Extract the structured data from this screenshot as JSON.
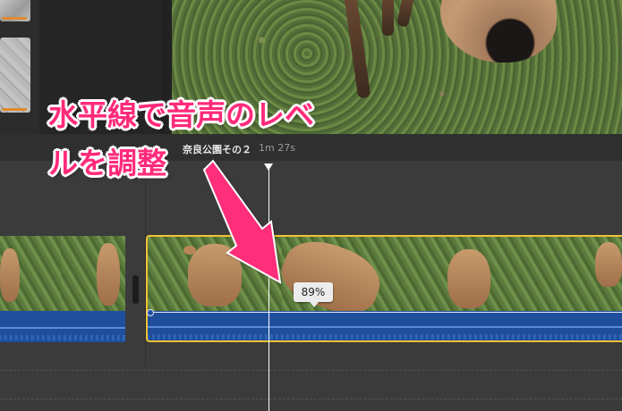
{
  "project": {
    "title": "奈良公園その２",
    "duration": "1m 27s"
  },
  "volume_tooltip": "89%",
  "volume_level": 0.89,
  "annotation": {
    "line1": "水平線で音声のレベ",
    "line2": "ルを調整"
  },
  "colors": {
    "annotation_text": "#ff2a7a",
    "arrow": "#ff2d7a",
    "selection_border": "#f0c233",
    "audio_track": "#1f4f9c",
    "playhead": "#ffffff"
  },
  "icons": {
    "playhead": "playhead-marker-icon",
    "arrow": "annotation-arrow-icon"
  }
}
